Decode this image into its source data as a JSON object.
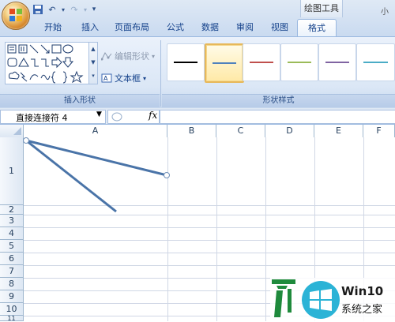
{
  "quick_access": {
    "save_icon": "save-icon",
    "undo_icon": "undo-icon",
    "redo_icon": "redo-icon",
    "customize_icon": "customize-qat-icon"
  },
  "context_tab_group": "绘图工具",
  "tabs": [
    "开始",
    "插入",
    "页面布局",
    "公式",
    "数据",
    "审阅",
    "视图",
    "格式"
  ],
  "active_tab": "格式",
  "help": "小",
  "ribbon": {
    "groups": {
      "insert_shapes": "插入形状",
      "shape_styles": "形状样式"
    },
    "edit_shape": "编辑形状",
    "text_box": "文本框",
    "style_colors": [
      "#000000",
      "#4f81bd",
      "#c0504d",
      "#9bbb59",
      "#8064a2",
      "#4bacc6"
    ],
    "selected_style_index": 1
  },
  "formula_bar": {
    "name_box": "直接连接符 4",
    "fx": "fx",
    "formula": ""
  },
  "columns": [
    "A",
    "B",
    "C",
    "D",
    "E",
    "F"
  ],
  "rows": [
    "1",
    "2",
    "3",
    "4",
    "5",
    "6",
    "7",
    "8",
    "9",
    "10",
    "11"
  ],
  "watermark": {
    "title": "Win10",
    "subtitle": "系统之家"
  }
}
